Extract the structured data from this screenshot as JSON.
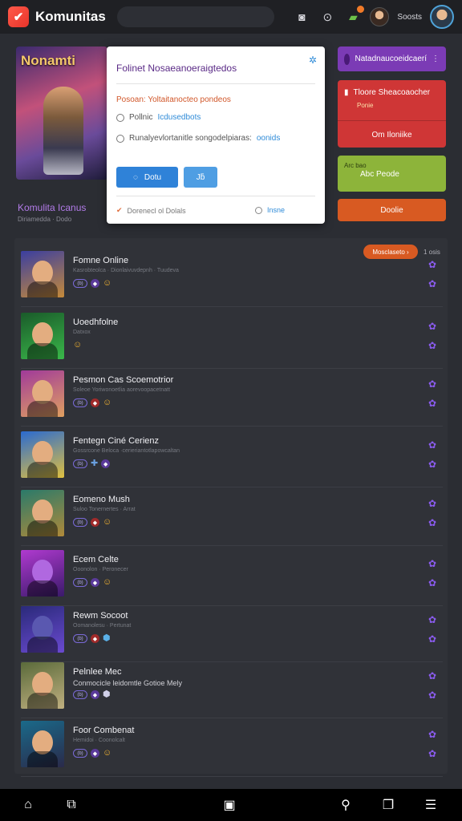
{
  "app": {
    "title": "Komunitas",
    "logo_glyph": "✔"
  },
  "topbar": {
    "icons": [
      "camera-icon",
      "coin-icon",
      "notification-icon"
    ],
    "username": "Soosts"
  },
  "hero": {
    "title": "Nonamti",
    "community_title": "Komulita Icanus",
    "community_sub": "Diriamedda · Dodo"
  },
  "popup": {
    "title": "Folinet Nosaeanoeraigtedos",
    "line1_prefix": "Posoan:",
    "line1_value": "Yoltaitanocteo pondeos",
    "row1_text": "Pollnic",
    "row1_link": "Icdusedbots",
    "row2_text": "Runalyevlortanitle songodelpiaras:",
    "row2_link": "oonids",
    "primary_button": "Dotu",
    "secondary_button": "Jƃ",
    "footer_left": "Dorenecl ol Dolals",
    "footer_right": "Insne"
  },
  "right_panel": {
    "purple_label": "Natadnaucoeidcaerí",
    "red_title": "Tloore Sheacoaocher",
    "red_sub": "Ponie",
    "red_action": "Om Iloniike",
    "green_small": "Arc bao",
    "green_title": "Abc Peode",
    "orange_label": "Doolie"
  },
  "list": {
    "badge": "Mosclaseto",
    "badge_count": "1 osis",
    "items": [
      {
        "title": "Fomne Online",
        "sub": "Kasrobteolca · Dionlaivuvdepnh · Tuudeva",
        "chip": "(b)"
      },
      {
        "title": "Uoedhfolne",
        "sub": "Datxox",
        "chip": "(b)"
      },
      {
        "title": "Pesmon Cas Scoemotrior",
        "sub": "Soleoe Yoriwonoetlia aorevoopacetnatt",
        "chip": "(b)"
      },
      {
        "title": "Fentegn Ciné Cerienz",
        "sub": "Gossrcone Beloca ·cerieriantotlapowcaltan",
        "chip": "(b)"
      },
      {
        "title": "Eomeno Mush",
        "sub": "Suloo Tonernertes · Arrat",
        "chip": "(b)"
      },
      {
        "title": "Ecem Celte",
        "sub": "Ooonolon · Peronecer",
        "chip": "(b)"
      },
      {
        "title": "Rewm Socoot",
        "sub": "Oomanolesu · Pertunat",
        "chip": "(b)"
      },
      {
        "title": "Pelnlee Mec",
        "sub": "Conmocicle leidomtle Gotioe Mely",
        "chip": "(b)"
      },
      {
        "title": "Foor Combenat",
        "sub": "Hemidoi · Coonolcalt",
        "chip": "(b)"
      }
    ]
  },
  "bottom_nav": [
    "home-icon",
    "puzzle-icon",
    "box-icon",
    "search-icon",
    "tabs-icon",
    "menu-icon"
  ],
  "colors": {
    "accent": "#8b5cf0",
    "danger": "#cf3636",
    "success": "#8db43a",
    "warning": "#d85a22"
  }
}
